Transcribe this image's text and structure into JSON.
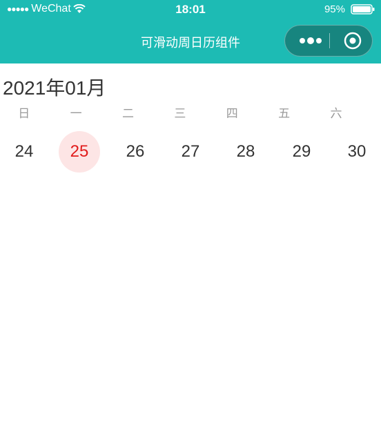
{
  "status_bar": {
    "signal": "●●●●●",
    "carrier": "WeChat",
    "time": "18:01",
    "battery": "95%"
  },
  "nav": {
    "title": "可滑动周日历组件"
  },
  "calendar": {
    "month_title": "2021年01月",
    "weekdays": [
      "日",
      "一",
      "二",
      "三",
      "四",
      "五",
      "六"
    ],
    "days": [
      "24",
      "25",
      "26",
      "27",
      "28",
      "29",
      "30"
    ],
    "selected_day": "25"
  },
  "colors": {
    "header": "#1dbbb4",
    "selected_text": "#e11b1b",
    "selected_bg": "#fde5e5"
  },
  "icons": {
    "more": "more-dots-icon",
    "close": "target-close-icon",
    "wifi": "wifi-icon",
    "battery": "battery-icon"
  }
}
